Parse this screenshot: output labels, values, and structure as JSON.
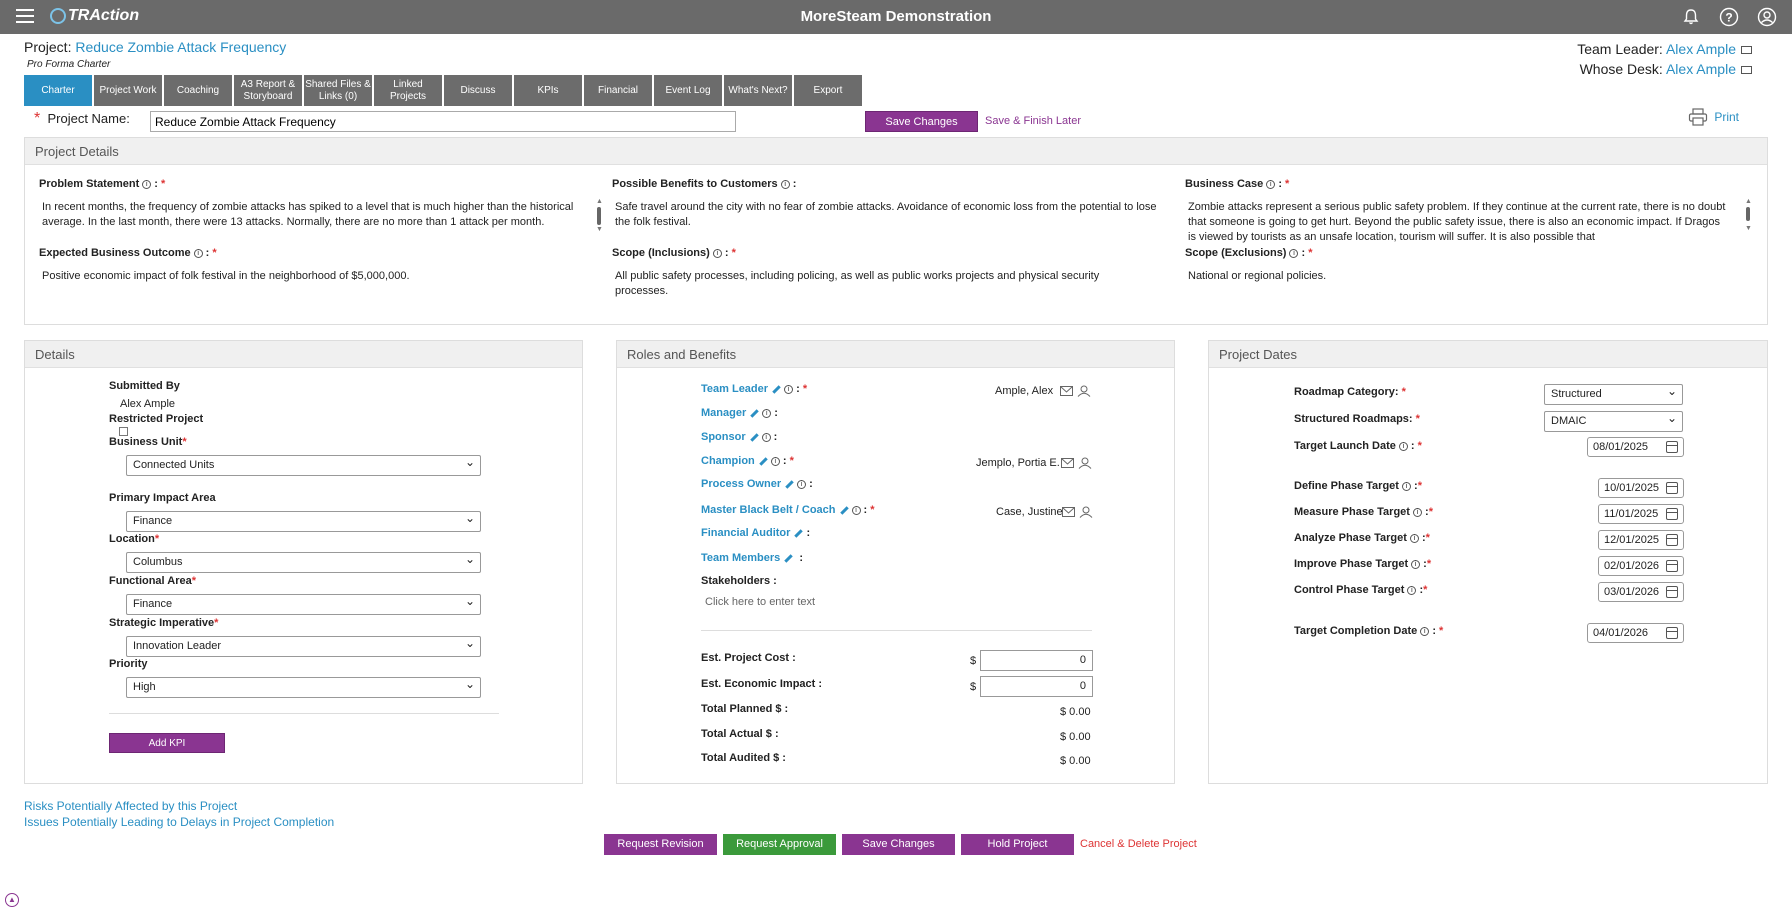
{
  "app": {
    "title": "MoreSteam Demonstration",
    "logo": "TRAction"
  },
  "project": {
    "label": "Project:",
    "name": "Reduce Zombie Attack Frequency",
    "subtitle": "Pro Forma Charter"
  },
  "header_right": {
    "team_leader_label": "Team Leader:",
    "team_leader": "Alex Ample",
    "whose_desk_label": "Whose Desk:",
    "whose_desk": "Alex Ample"
  },
  "tabs": [
    {
      "label": "Charter",
      "active": true
    },
    {
      "label": "Project Work"
    },
    {
      "label": "Coaching"
    },
    {
      "label": "A3 Report & Storyboard"
    },
    {
      "label": "Shared Files & Links (0)"
    },
    {
      "label": "Linked Projects"
    },
    {
      "label": "Discuss"
    },
    {
      "label": "KPIs"
    },
    {
      "label": "Financial"
    },
    {
      "label": "Event Log"
    },
    {
      "label": "What's Next?"
    },
    {
      "label": "Export"
    }
  ],
  "name_row": {
    "label": "Project Name:",
    "value": "Reduce Zombie Attack Frequency",
    "save": "Save Changes",
    "save_later": "Save & Finish Later",
    "print": "Print"
  },
  "project_details": {
    "title": "Project Details",
    "problem_label": "Problem Statement",
    "problem_text": "In recent months, the frequency of zombie attacks has spiked to a level that is much higher than the historical average.  In the last month, there were 13 attacks. Normally, there are no more than 1 attack per month.",
    "benefits_label": "Possible Benefits to Customers",
    "benefits_text": "Safe travel around the city with no fear of zombie attacks.   Avoidance of economic loss from the potential to lose the folk festival.",
    "business_label": "Business Case",
    "business_text": "Zombie attacks represent a serious public safety problem.   If they continue at the current rate, there is no doubt that someone is going to get hurt.  Beyond the public safety issue, there is also an economic impact.  If Dragos is viewed by tourists as an unsafe location, tourism will suffer.  It is also possible that",
    "outcome_label": "Expected Business Outcome",
    "outcome_text": "Positive economic impact of folk festival in the neighborhood of $5,000,000.",
    "scope_in_label": "Scope (Inclusions)",
    "scope_in_text": "All public safety processes, including policing, as well as public works projects and physical security processes.",
    "scope_ex_label": "Scope (Exclusions)",
    "scope_ex_text": "National or regional policies."
  },
  "details": {
    "title": "Details",
    "submitted_by_label": "Submitted By",
    "submitted_by": "Alex Ample",
    "restricted_label": "Restricted Project",
    "business_unit_label": "Business Unit",
    "business_unit": "Connected Units",
    "impact_label": "Primary Impact Area",
    "impact": "Finance",
    "location_label": "Location",
    "location": "Columbus",
    "functional_label": "Functional Area",
    "functional": "Finance",
    "strategic_label": "Strategic Imperative",
    "strategic": "Innovation Leader",
    "priority_label": "Priority",
    "priority": "High",
    "add_kpi": "Add KPI"
  },
  "roles": {
    "title": "Roles and Benefits",
    "team_leader": "Team Leader",
    "team_leader_val": "Ample, Alex",
    "manager": "Manager",
    "sponsor": "Sponsor",
    "champion": "Champion",
    "champion_val": "Jemplo, Portia E.",
    "process_owner": "Process Owner",
    "mbb": "Master Black Belt / Coach",
    "mbb_val": "Case, Justine",
    "fin_auditor": "Financial Auditor",
    "team_members": "Team Members",
    "stakeholders": "Stakeholders :",
    "stakeholders_placeholder": "Click here to enter text",
    "est_cost_label": "Est. Project Cost :",
    "est_cost": "0",
    "est_impact_label": "Est. Economic Impact :",
    "est_impact": "0",
    "currency": "$",
    "planned_label": "Total Planned $ :",
    "planned": "$ 0.00",
    "actual_label": "Total Actual $ :",
    "actual": "$ 0.00",
    "audited_label": "Total Audited $ :",
    "audited": "$ 0.00"
  },
  "dates": {
    "title": "Project Dates",
    "roadmap_cat_label": "Roadmap Category:",
    "roadmap_cat": "Structured",
    "roadmaps_label": "Structured Roadmaps:",
    "roadmaps": "DMAIC",
    "launch_label": "Target Launch Date",
    "launch": "08/01/2025",
    "define_label": "Define Phase Target",
    "define": "10/01/2025",
    "measure_label": "Measure Phase Target",
    "measure": "11/01/2025",
    "analyze_label": "Analyze Phase Target",
    "analyze": "12/01/2025",
    "improve_label": "Improve Phase Target",
    "improve": "02/01/2026",
    "control_label": "Control Phase Target",
    "control": "03/01/2026",
    "completion_label": "Target Completion Date",
    "completion": "04/01/2026"
  },
  "footer_links": {
    "risks": "Risks Potentially Affected by this Project",
    "issues": "Issues Potentially Leading to Delays in Project Completion"
  },
  "actions": {
    "revision": "Request Revision",
    "approval": "Request Approval",
    "save": "Save Changes",
    "hold": "Hold Project",
    "cancel": "Cancel & Delete Project"
  },
  "colors": {
    "accent": "#2a8fc3",
    "purple": "#8a3591",
    "green": "#3b9a3b",
    "required": "#d33333",
    "topbar": "#6a6a6a"
  }
}
